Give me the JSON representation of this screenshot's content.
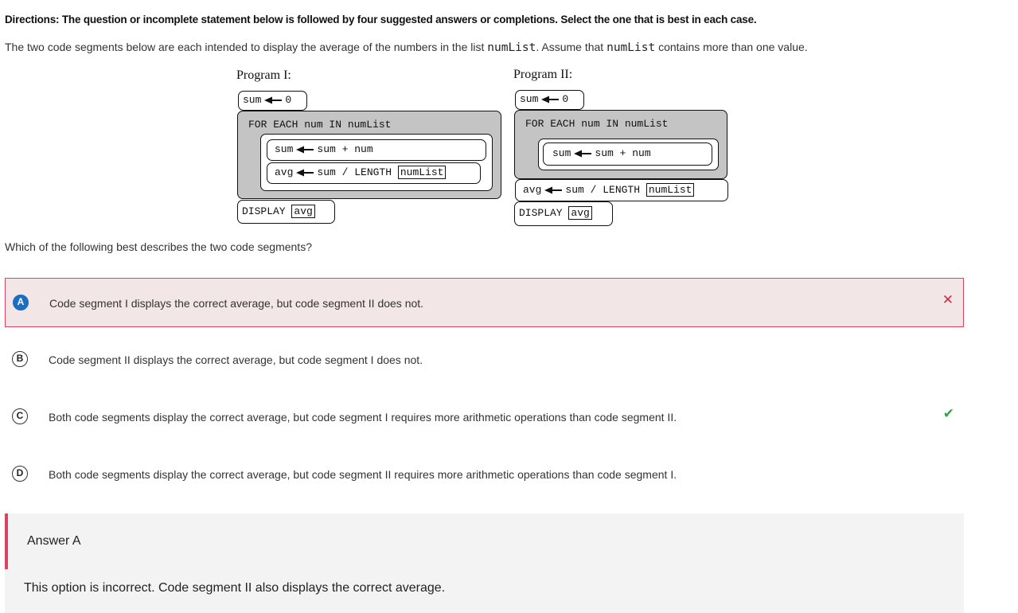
{
  "directions": "Directions: The question or incomplete statement below is followed by four suggested answers or completions. Select the one that is best in each case.",
  "stem": {
    "part1": "The two code segments below are each intended to display the average of the numbers in the list ",
    "code1": "numList",
    "part2": ". Assume that ",
    "code2": "numList",
    "part3": " contains more than one value."
  },
  "program1": {
    "title": "Program I:",
    "init_var": "sum",
    "init_val": "0",
    "loop_header": "FOR EACH num IN numList",
    "stmt1_var": "sum",
    "stmt1_expr": "sum + num",
    "stmt2_var": "avg",
    "stmt2_expr": "sum / LENGTH",
    "stmt2_arg": "numList",
    "display_kw": "DISPLAY",
    "display_arg": "avg"
  },
  "program2": {
    "title": "Program II:",
    "init_var": "sum",
    "init_val": "0",
    "loop_header": "FOR EACH num IN numList",
    "stmt1_var": "sum",
    "stmt1_expr": "sum + num",
    "stmt2_var": "avg",
    "stmt2_expr": "sum / LENGTH",
    "stmt2_arg": "numList",
    "display_kw": "DISPLAY",
    "display_arg": "avg"
  },
  "question": "Which of the following best describes the two code segments?",
  "options": [
    {
      "letter": "A",
      "text": "Code segment I displays the correct average, but code segment II does not.",
      "mark": "✕"
    },
    {
      "letter": "B",
      "text": "Code segment II displays the correct average, but code segment I does not."
    },
    {
      "letter": "C",
      "text": "Both code segments display the correct average, but code segment I requires more arithmetic operations than code segment II.",
      "mark": "✔"
    },
    {
      "letter": "D",
      "text": "Both code segments display the correct average, but code segment II requires more arithmetic operations than code segment I."
    }
  ],
  "feedback": {
    "title": "Answer A",
    "text": "This option is incorrect. Code segment II also displays the correct average."
  },
  "colors": {
    "selected": "#1a6fc2",
    "incorrect": "#d42b45",
    "correct": "#3aa04a",
    "incorrect_bg": "#f2e6e7",
    "block_gray": "#c4c4c4"
  }
}
